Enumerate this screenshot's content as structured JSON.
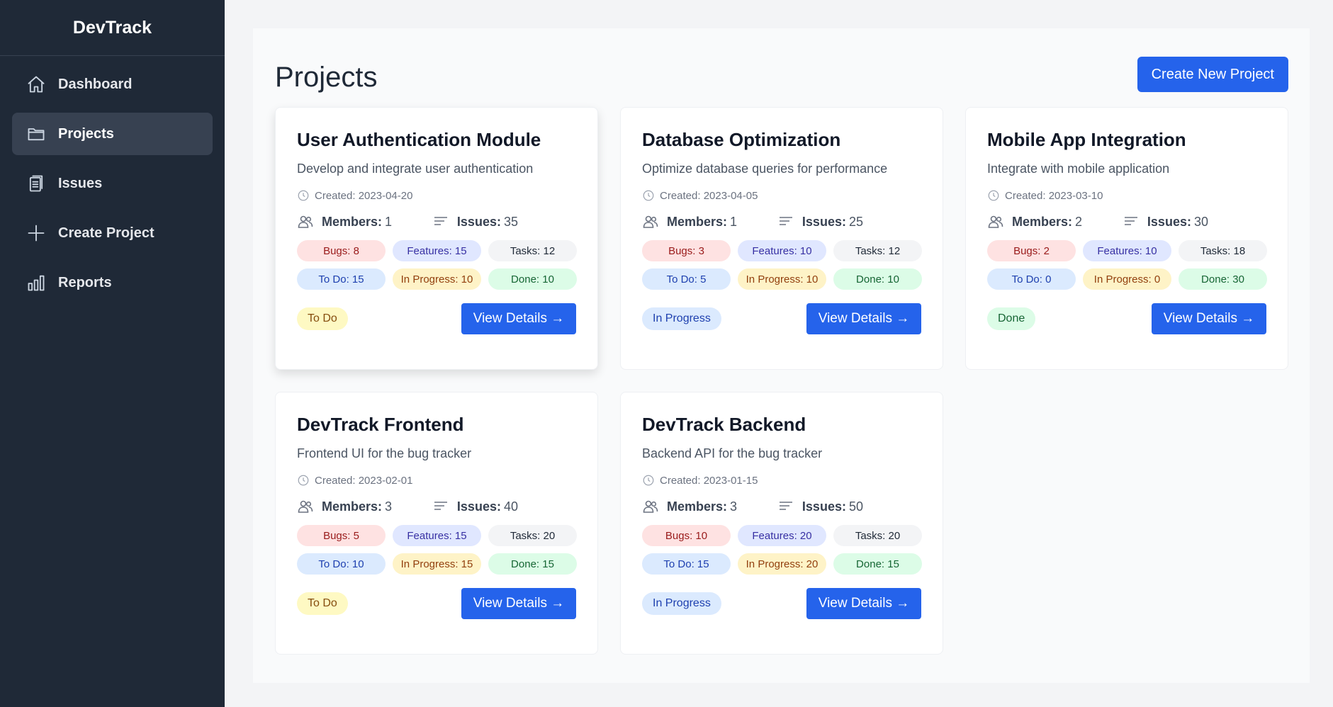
{
  "app": {
    "brand": "DevTrack"
  },
  "sidebar": {
    "items": [
      {
        "label": "Dashboard",
        "icon": "home-icon",
        "active": false
      },
      {
        "label": "Projects",
        "icon": "folder-icon",
        "active": true
      },
      {
        "label": "Issues",
        "icon": "clipboard-icon",
        "active": false
      },
      {
        "label": "Create Project",
        "icon": "plus-icon",
        "active": false
      },
      {
        "label": "Reports",
        "icon": "bar-chart-icon",
        "active": false
      }
    ]
  },
  "main": {
    "title": "Projects",
    "create_button": "Create New Project",
    "view_details_label": "View Details →",
    "members_label": "Members:",
    "issues_label": "Issues:",
    "projects": [
      {
        "title": "User Authentication Module",
        "description": "Develop and integrate user authentication",
        "created": "Created: 2023-04-20",
        "members": "1",
        "issues": "35",
        "pills": [
          "Bugs: 8",
          "Features: 15",
          "Tasks: 12",
          "To Do: 15",
          "In Progress: 10",
          "Done: 10"
        ],
        "status": "To Do"
      },
      {
        "title": "Database Optimization",
        "description": "Optimize database queries for performance",
        "created": "Created: 2023-04-05",
        "members": "1",
        "issues": "25",
        "pills": [
          "Bugs: 3",
          "Features: 10",
          "Tasks: 12",
          "To Do: 5",
          "In Progress: 10",
          "Done: 10"
        ],
        "status": "In Progress"
      },
      {
        "title": "Mobile App Integration",
        "description": "Integrate with mobile application",
        "created": "Created: 2023-03-10",
        "members": "2",
        "issues": "30",
        "pills": [
          "Bugs: 2",
          "Features: 10",
          "Tasks: 18",
          "To Do: 0",
          "In Progress: 0",
          "Done: 30"
        ],
        "status": "Done"
      },
      {
        "title": "DevTrack Frontend",
        "description": "Frontend UI for the bug tracker",
        "created": "Created: 2023-02-01",
        "members": "3",
        "issues": "40",
        "pills": [
          "Bugs: 5",
          "Features: 15",
          "Tasks: 20",
          "To Do: 10",
          "In Progress: 15",
          "Done: 15"
        ],
        "status": "To Do"
      },
      {
        "title": "DevTrack Backend",
        "description": "Backend API for the bug tracker",
        "created": "Created: 2023-01-15",
        "members": "3",
        "issues": "50",
        "pills": [
          "Bugs: 10",
          "Features: 20",
          "Tasks: 20",
          "To Do: 15",
          "In Progress: 20",
          "Done: 15"
        ],
        "status": "In Progress"
      }
    ]
  },
  "colors": {
    "sidebar_bg": "#1f2937",
    "accent": "#2563eb",
    "page_bg": "#f3f4f6"
  }
}
